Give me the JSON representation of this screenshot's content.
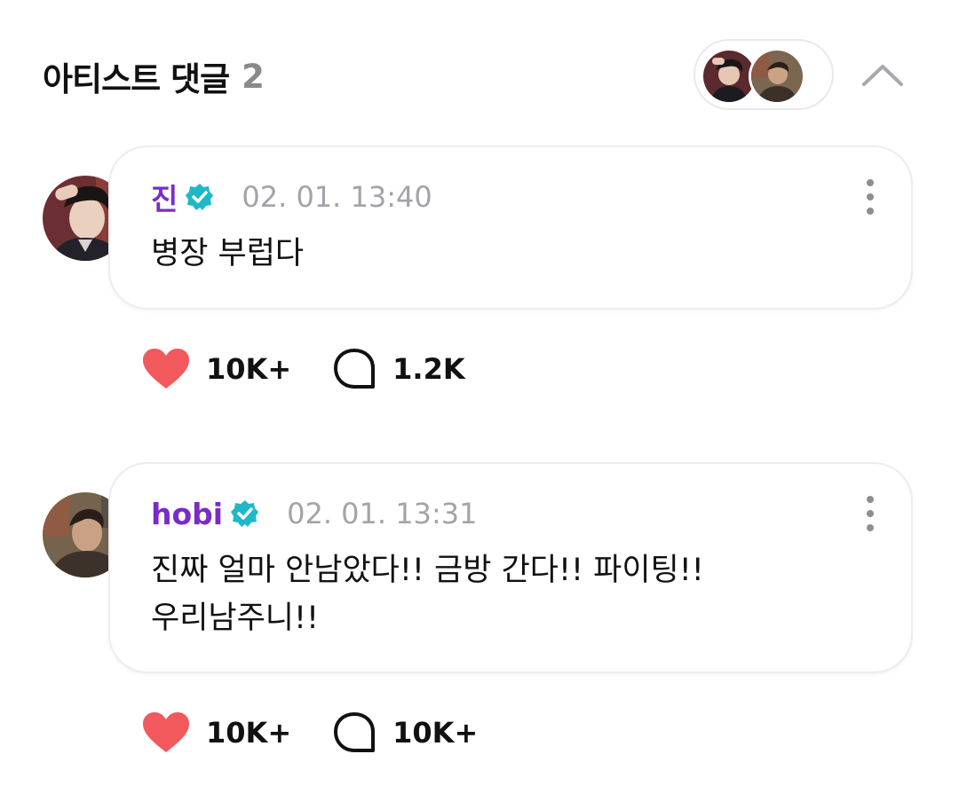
{
  "header": {
    "title": "아티스트 댓글",
    "count": "2"
  },
  "comments": [
    {
      "author": "진",
      "timestamp": "02. 01. 13:40",
      "text_lines": [
        "병장 부럽다"
      ],
      "likes": "10K+",
      "replies": "1.2K"
    },
    {
      "author": "hobi",
      "timestamp": "02. 01. 13:31",
      "text_lines": [
        "진짜 얼마 안남았다!! 금방 간다!! 파이팅!!",
        "우리남주니!!"
      ],
      "likes": "10K+",
      "replies": "10K+"
    }
  ],
  "colors": {
    "author": "#7a2cc8",
    "verified_badge": "#1fb8c6",
    "like_heart": "#f1595d",
    "timestamp": "#a3a3a8"
  },
  "icons": {
    "collapse": "chevron-up-icon",
    "verified": "verified-badge-icon",
    "like": "heart-icon",
    "reply": "speech-bubble-icon",
    "more": "kebab-menu-icon"
  }
}
